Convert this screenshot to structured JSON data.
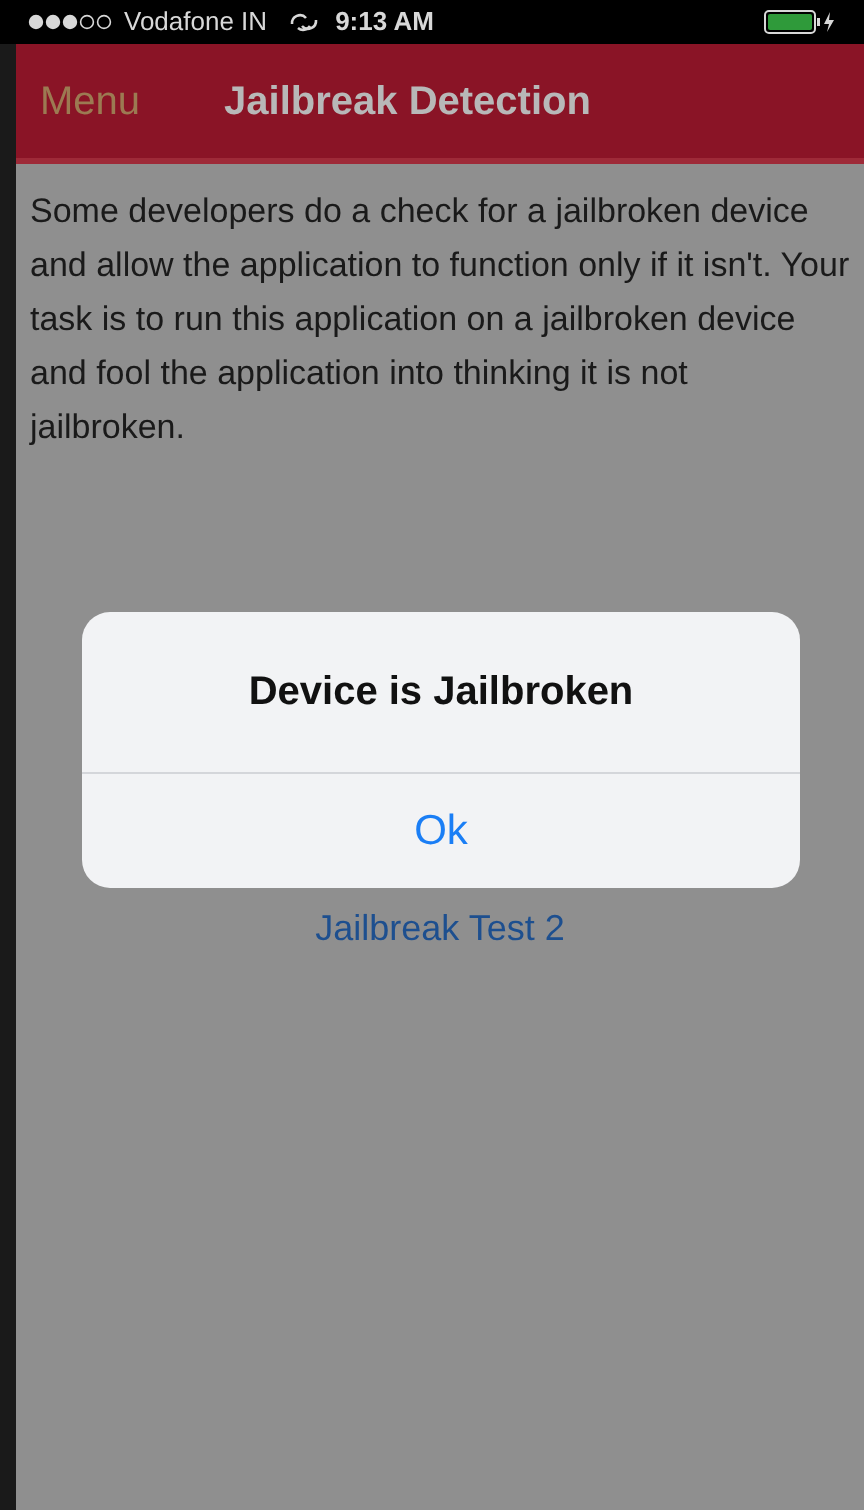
{
  "status_bar": {
    "carrier": "Vodafone IN",
    "time": "9:13 AM"
  },
  "nav_bar": {
    "menu": "Menu",
    "title": "Jailbreak Detection"
  },
  "description": "Some developers do a check for a jailbroken device and allow the application to function only if it isn't. Your task is to run this application on a jailbroken device and fool the application into thinking it is not jailbroken.",
  "links": [
    "Jailbreak Test 2"
  ],
  "alert": {
    "title": "Device is Jailbroken",
    "button": "Ok"
  }
}
